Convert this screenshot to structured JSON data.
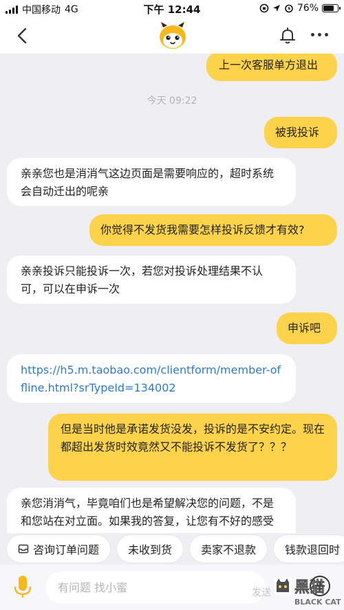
{
  "status_bar": {
    "carrier": "中国移动",
    "network": "4G",
    "time": "下午 12:44",
    "battery": "76%"
  },
  "nav": {
    "mascot_icon": "mascot-icon",
    "bell_icon": "bell-icon"
  },
  "chat": {
    "timestamp": "今天 09:22",
    "messages": [
      {
        "side": "out",
        "text": "上一次客服单方退出"
      },
      {
        "side": "out",
        "text": "被我投诉"
      },
      {
        "side": "in",
        "text": "亲亲您也是消消气这边页面是需要响应的，超时系统会自动迁出的呢亲"
      },
      {
        "side": "out",
        "text": "你觉得不发货我需要怎样投诉反馈才有效?"
      },
      {
        "side": "in",
        "text": "亲亲投诉只能投诉一次，若您对投诉处理结果不认可，可以在申诉一次"
      },
      {
        "side": "out",
        "text": "申诉吧"
      },
      {
        "side": "in",
        "text": "https://h5.m.taobao.com/clientform/member-offline.html?srTypeId=134002"
      },
      {
        "side": "out",
        "text": "但是当时他是承诺发货没发，投诉的是不安约定。现在都超出发货时效竟然又不能投诉不发货了？？？"
      },
      {
        "side": "in",
        "text": "亲您消消气，毕竟咱们也是希望解决您的问题，不是和您站在对立面。如果我的答复，让您有不好的感受了，十二感到非常的抱歉，其实十二心里也是"
      }
    ]
  },
  "chips": [
    "咨询订单问题",
    "未收到货",
    "卖家不退款",
    "钱款退回时"
  ],
  "input": {
    "placeholder": "有问题 找小蜜",
    "send_label": "发送"
  },
  "watermark": {
    "title": "黑猫",
    "subtitle": "BLACK CAT"
  },
  "colors": {
    "accent": "#fcd34a",
    "link": "#2e7ad1",
    "background": "#efeff3"
  }
}
